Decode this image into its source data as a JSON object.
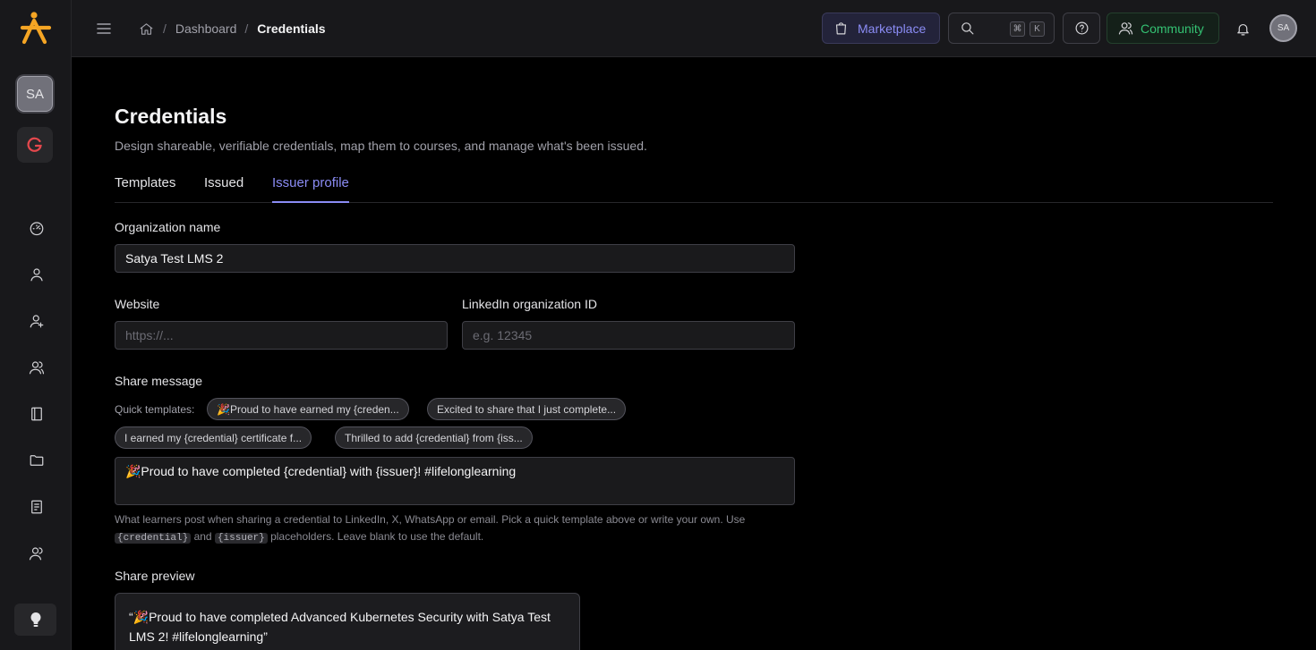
{
  "sidebar": {
    "workspace_initials": "SA",
    "items": [
      "dashboard-icon",
      "user-icon",
      "user-add-icon",
      "users-icon",
      "book-icon",
      "folder-icon",
      "report-icon",
      "team-icon"
    ]
  },
  "header": {
    "breadcrumb": {
      "dashboard": "Dashboard",
      "separator": "/",
      "current": "Credentials"
    },
    "marketplace_label": "Marketplace",
    "kbd_cmd": "⌘",
    "kbd_k": "K",
    "community_label": "Community",
    "avatar_initials": "SA"
  },
  "page": {
    "title": "Credentials",
    "subtitle": "Design shareable, verifiable credentials, map them to courses, and manage what's been issued.",
    "tabs": [
      {
        "label": "Templates",
        "active": false
      },
      {
        "label": "Issued",
        "active": false
      },
      {
        "label": "Issuer profile",
        "active": true
      }
    ]
  },
  "form": {
    "org_name_label": "Organization name",
    "org_name_value": "Satya Test LMS 2",
    "website_label": "Website",
    "website_placeholder": "https://...",
    "linkedin_label": "LinkedIn organization ID",
    "linkedin_placeholder": "e.g. 12345",
    "share_message_label": "Share message",
    "quick_templates_label": "Quick templates:",
    "quick_templates": [
      "🎉Proud to have earned my {creden...",
      "Excited to share that I just complete...",
      "I earned my {credential} certificate f...",
      "Thrilled to add {credential} from {iss..."
    ],
    "share_message_value": "🎉Proud to have completed {credential} with {issuer}! #lifelonglearning",
    "help_text_1": "What learners post when sharing a credential to LinkedIn, X, WhatsApp or email. Pick a quick template above or write your own. Use",
    "help_code_1": "{credential}",
    "help_and": "and",
    "help_code_2": "{issuer}",
    "help_text_2": "placeholders. Leave blank to use the default.",
    "share_preview_label": "Share preview",
    "share_preview_text": "“🎉Proud to have completed Advanced Kubernetes Security with Satya Test LMS 2! #lifelonglearning”"
  },
  "colors": {
    "accent": "#8b8cf5",
    "community": "#34c273",
    "brand_logo": "#f5a524",
    "background": "#000000",
    "sidebar": "#18181b"
  }
}
